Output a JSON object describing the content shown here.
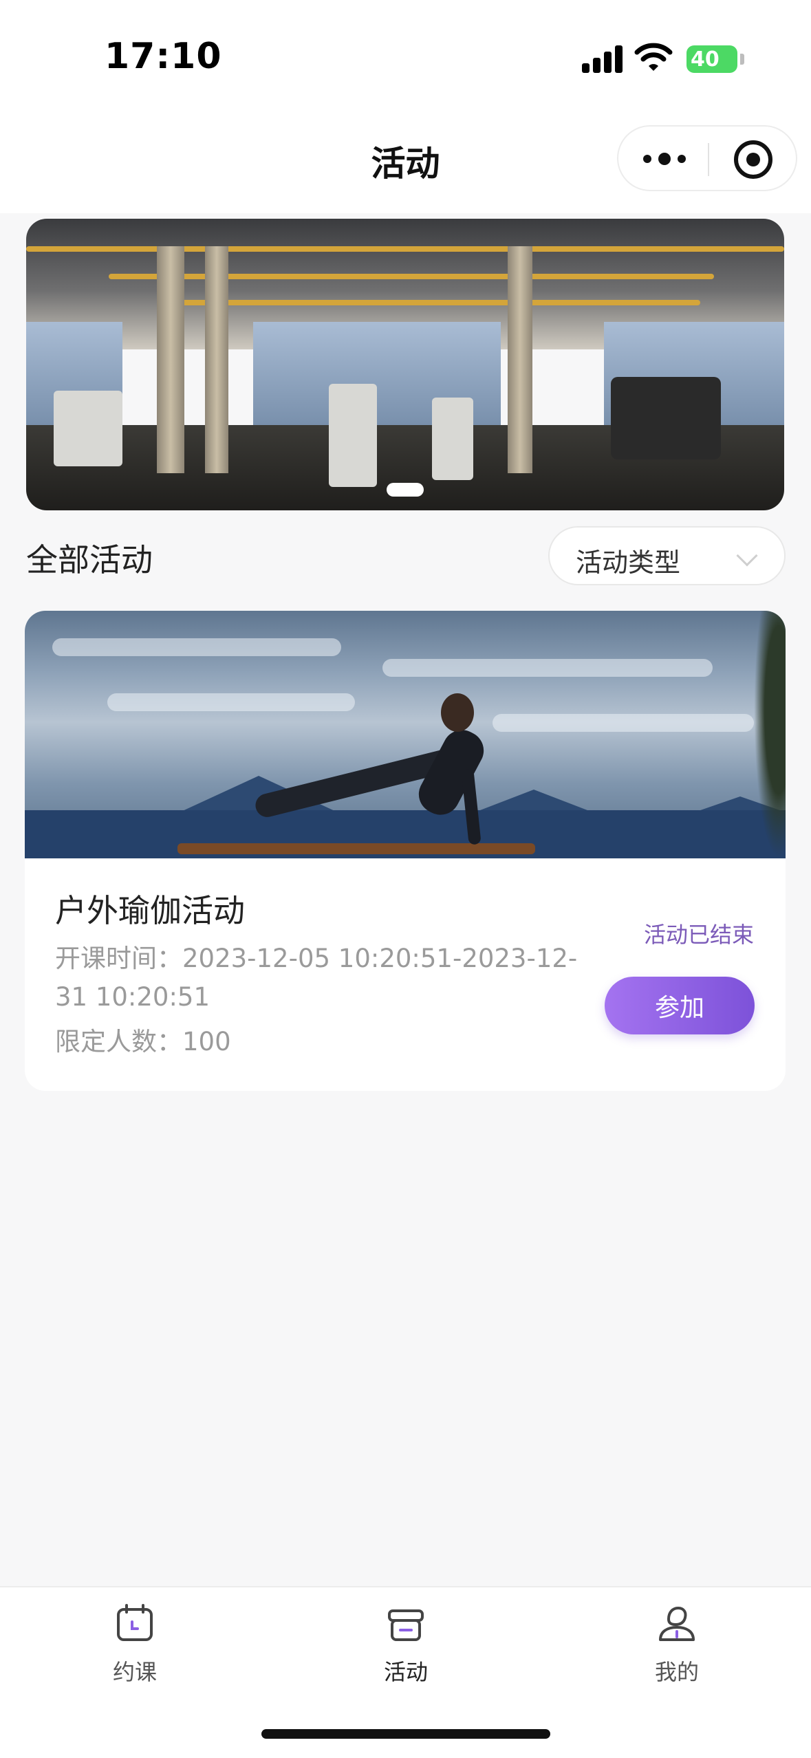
{
  "status_bar": {
    "time": "17:10",
    "battery": "40"
  },
  "nav": {
    "title": "活动",
    "more_icon": "more-dots-icon",
    "close_icon": "target-close-icon"
  },
  "banner": {
    "image": "gym-interior",
    "page_count": 1,
    "active_page": 1
  },
  "section": {
    "title": "全部活动",
    "filter_label": "活动类型",
    "filter_icon": "chevron-down-icon"
  },
  "activities": [
    {
      "title": "户外瑜伽活动",
      "time": "开课时间：2023-12-05 10:20:51-2023-12-31 10:20:51",
      "limit": "限定人数：100",
      "status": "活动已结束",
      "button": "参加",
      "image": "outdoor-yoga"
    }
  ],
  "tabs": [
    {
      "label": "约课",
      "icon": "calendar-icon",
      "active": false
    },
    {
      "label": "活动",
      "icon": "gift-box-icon",
      "active": true
    },
    {
      "label": "我的",
      "icon": "profile-icon",
      "active": false
    }
  ],
  "colors": {
    "accent": "#8b5fe3",
    "status_text": "#7b5ab8",
    "battery": "#4cd964"
  }
}
